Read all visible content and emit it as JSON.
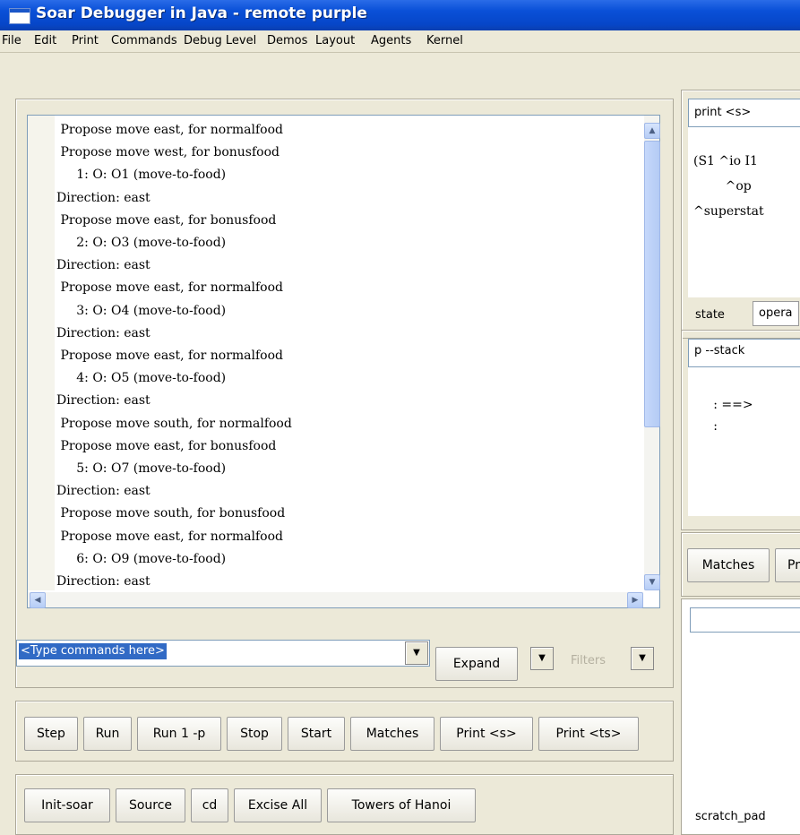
{
  "window": {
    "title": "Soar Debugger in Java - remote purple"
  },
  "menu": [
    "File",
    "Edit",
    "Print",
    "Commands",
    "Debug Level",
    "Demos",
    "Layout",
    "Agents",
    "Kernel"
  ],
  "trace": {
    "lines": [
      " Propose move east, for normalfood",
      " Propose move west, for bonusfood",
      "     1: O: O1 (move-to-food)",
      "Direction: east",
      " Propose move east, for bonusfood",
      "     2: O: O3 (move-to-food)",
      "Direction: east",
      " Propose move east, for normalfood",
      "     3: O: O4 (move-to-food)",
      "Direction: east",
      " Propose move east, for normalfood",
      "     4: O: O5 (move-to-food)",
      "Direction: east",
      " Propose move south, for normalfood",
      " Propose move east, for bonusfood",
      "     5: O: O7 (move-to-food)",
      "Direction: east",
      " Propose move south, for bonusfood",
      " Propose move east, for normalfood",
      "     6: O: O9 (move-to-food)",
      "Direction: east"
    ]
  },
  "command": {
    "value": "<Type commands here>",
    "expand_label": "Expand",
    "filters_label": "Filters"
  },
  "buttons_row1": [
    "Step",
    "Run",
    "Run 1 -p",
    "Stop",
    "Start",
    "Matches",
    "Print <s>",
    "Print <ts>"
  ],
  "buttons_row2": [
    "Init-soar",
    "Source",
    "cd",
    "Excise All",
    "Towers of Hanoi"
  ],
  "right": {
    "state_cmd": "print <s>",
    "state_lines": [
      "(S1 ^io I1",
      "        ^op",
      "^superstat"
    ],
    "state_tabs": [
      "state",
      "opera"
    ],
    "stack_cmd": "p --stack",
    "stack_lines": [
      "     : ==>",
      "     :"
    ],
    "match_tabs": [
      "Matches",
      "Pr"
    ],
    "scratch_label": "scratch_pad"
  }
}
